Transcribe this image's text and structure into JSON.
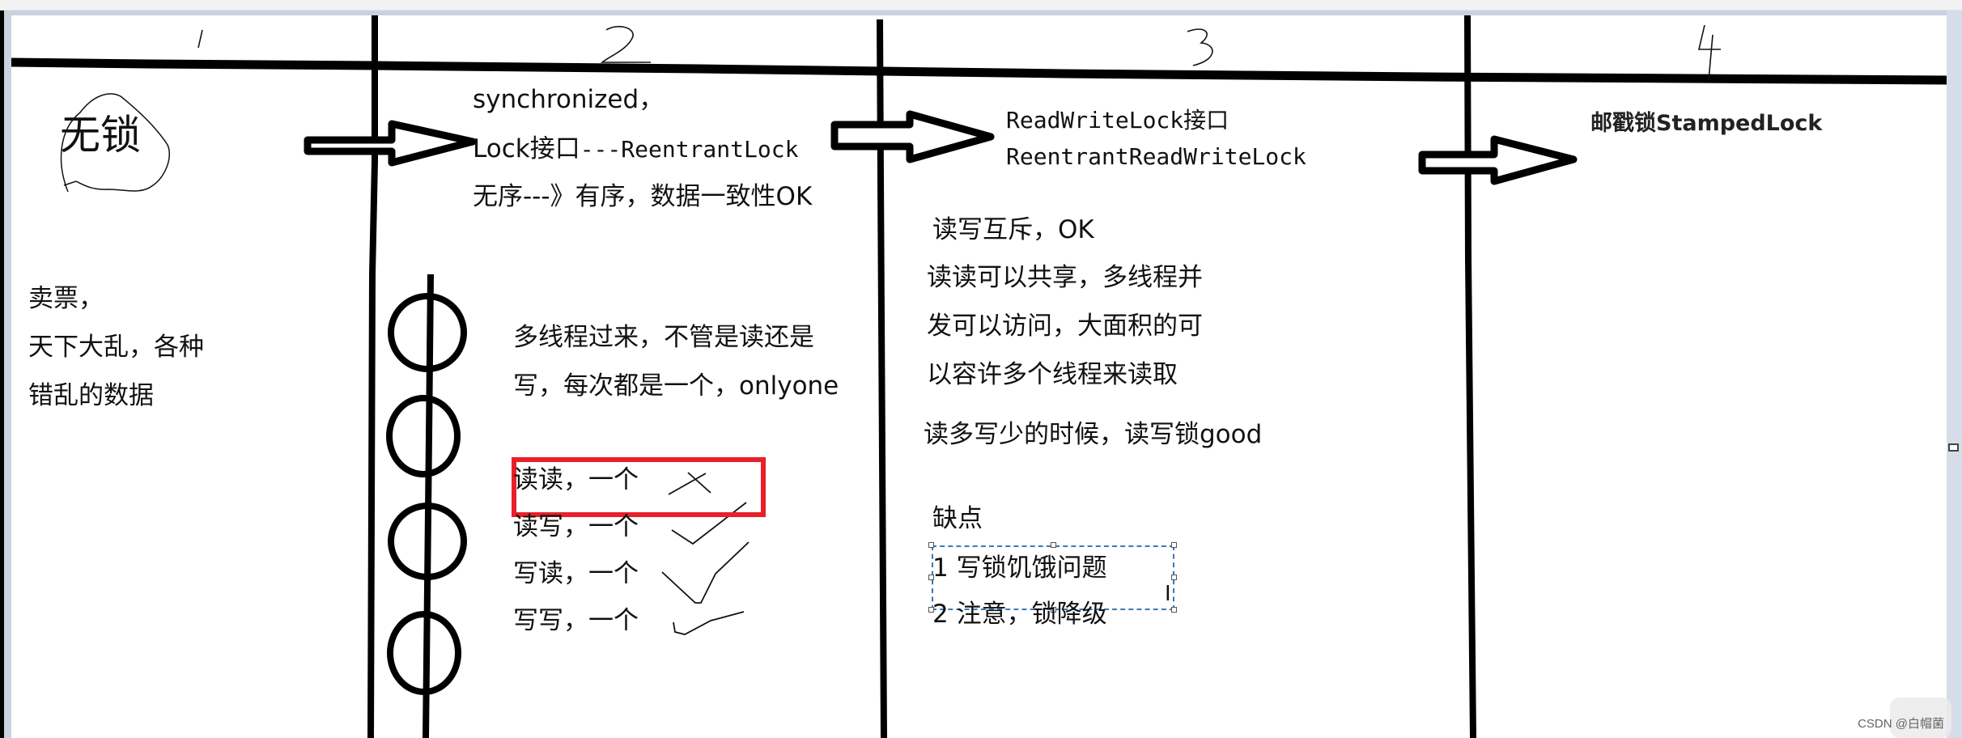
{
  "app": {
    "type": "paint-canvas",
    "watermark": "CSDN @白帽菌"
  },
  "columns": [
    {
      "number": "1"
    },
    {
      "number": "2"
    },
    {
      "number": "3"
    },
    {
      "number": "4"
    }
  ],
  "col1": {
    "title": "无锁",
    "lines": [
      "卖票，",
      "天下大乱，各种",
      "错乱的数据"
    ]
  },
  "col2": {
    "header_lines": [
      "synchronized，",
      "Lock接口",
      "---ReentrantLock",
      "无序---》有序，数据一致性OK"
    ],
    "desc_lines": [
      "多线程过来，不管是读还是",
      "写，每次都是一个，onlyone"
    ],
    "cases": [
      {
        "label": "读读，一个",
        "mark": "cross",
        "highlighted": true
      },
      {
        "label": "读写，一个",
        "mark": "check",
        "highlighted": false
      },
      {
        "label": "写读，一个",
        "mark": "check",
        "highlighted": false
      },
      {
        "label": "写写，一个",
        "mark": "check",
        "highlighted": false
      }
    ],
    "highlight_color": "#e8202a"
  },
  "col3": {
    "header_lines": [
      "ReadWriteLock接口",
      "ReentrantReadWriteLock"
    ],
    "desc_lines": [
      "读写互斥，OK",
      "读读可以共享，多线程并",
      "发可以访问，大面积的可",
      "以容许多个线程来读取"
    ],
    "summary": "读多写少的时候，读写锁good",
    "cons_title": "缺点",
    "cons": [
      "1 写锁饥饿问题",
      "2 注意，锁降级"
    ],
    "selection_color": "#3b79b3"
  },
  "col4": {
    "title": "邮戳锁StampedLock"
  }
}
